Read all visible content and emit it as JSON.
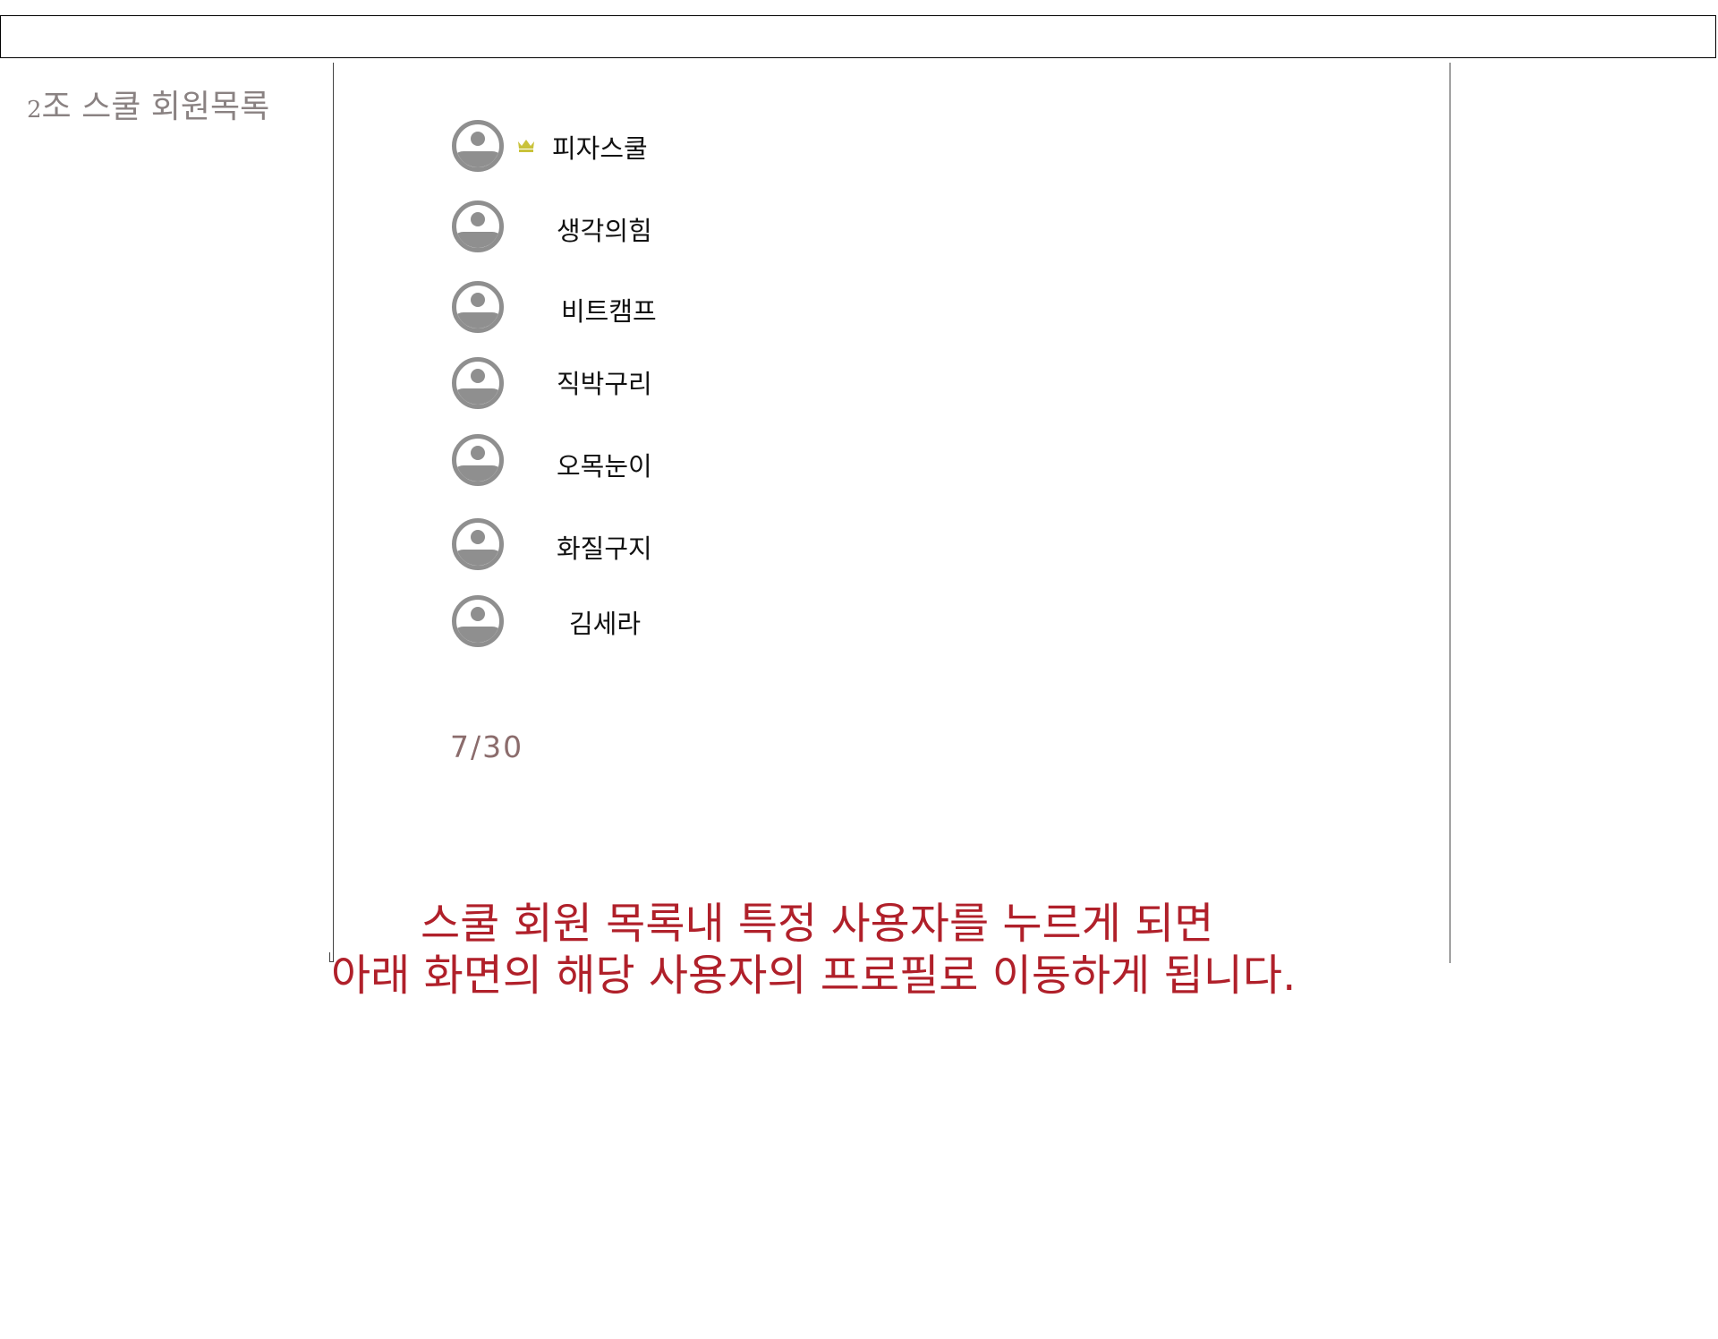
{
  "header": {
    "title_number": "2",
    "title_text": "조 스쿨 회원목록"
  },
  "members": [
    {
      "name": "피자스쿨",
      "badge": "crown-icon"
    },
    {
      "name": "생각의힘"
    },
    {
      "name": "비트캠프"
    },
    {
      "name": "직박구리"
    },
    {
      "name": "오목눈이"
    },
    {
      "name": "화질구지"
    },
    {
      "name": "김세라"
    }
  ],
  "member_count": "7/30",
  "caption": {
    "line1": "스쿨 회원 목록내 특정 사용자를 누르게 되면",
    "line2": "아래 화면의 해당 사용자의 프로필로 이동하게 됩니다."
  },
  "colors": {
    "avatar": "#8f8f8f",
    "crown": "#c9c23a",
    "caption": "#b0202a",
    "title": "#8a8282",
    "counter": "#8b6c6c"
  }
}
